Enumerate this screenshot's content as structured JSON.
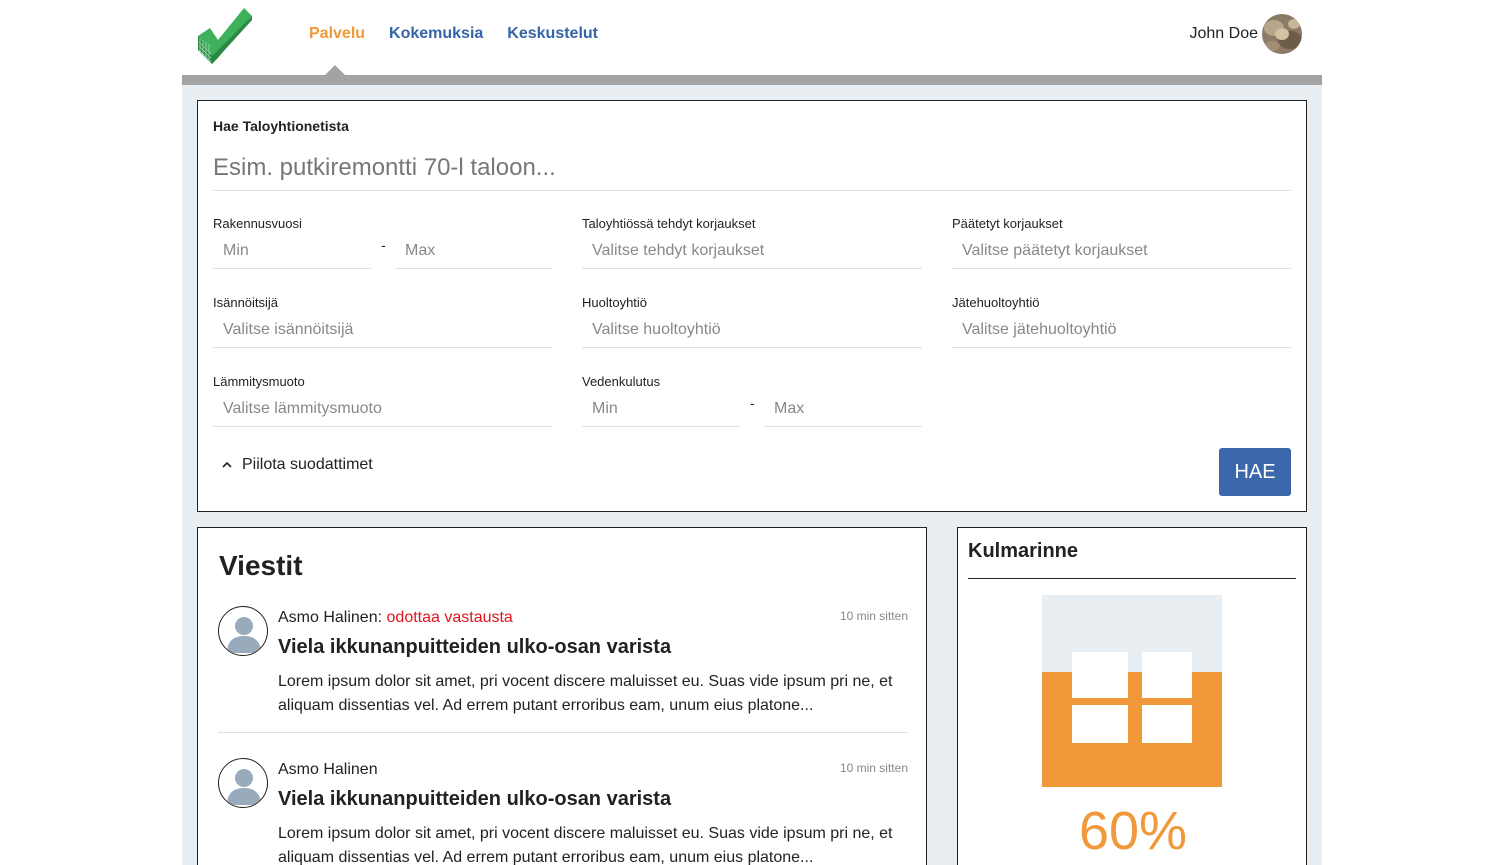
{
  "nav": {
    "items": [
      {
        "label": "Palvelu",
        "active": true
      },
      {
        "label": "Kokemuksia",
        "active": false
      },
      {
        "label": "Keskustelut",
        "active": false
      }
    ]
  },
  "user": {
    "name": "John Doe"
  },
  "search": {
    "title": "Hae Taloyhtionetista",
    "placeholder": "Esim. putkiremontti 70-l taloon...",
    "filters": {
      "rakennusvuosi": {
        "label": "Rakennusvuosi",
        "min_placeholder": "Min",
        "max_placeholder": "Max",
        "separator": "-"
      },
      "tehdyt": {
        "label": "Taloyhtiössä tehdyt korjaukset",
        "placeholder": "Valitse tehdyt korjaukset"
      },
      "paatetyt": {
        "label": "Päätetyt korjaukset",
        "placeholder": "Valitse päätetyt korjaukset"
      },
      "isannoitsija": {
        "label": "Isännöitsijä",
        "placeholder": "Valitse isännöitsijä"
      },
      "huoltoyhtio": {
        "label": "Huoltoyhtiö",
        "placeholder": "Valitse huoltoyhtiö"
      },
      "jatehuolto": {
        "label": "Jätehuoltoyhtiö",
        "placeholder": "Valitse jätehuoltoyhtiö"
      },
      "lammitys": {
        "label": "Lämmitysmuoto",
        "placeholder": "Valitse lämmitysmuoto"
      },
      "vedenkulutus": {
        "label": "Vedenkulutus",
        "min_placeholder": "Min",
        "max_placeholder": "Max",
        "separator": "-"
      }
    },
    "toggle_label": "Piilota suodattimet",
    "submit_label": "HAE"
  },
  "messages": {
    "title": "Viestit",
    "items": [
      {
        "author": "Asmo Halinen",
        "author_suffix": ":",
        "status": "odottaa vastausta",
        "time": "10 min sitten",
        "subject": "Viela ikkunanpuitteiden ulko-osan varista",
        "body": "Lorem ipsum dolor sit amet, pri vocent discere maluisset eu. Suas vide ipsum pri ne, et aliquam dissentias vel. Ad errem putant erroribus eam, unum eius platone..."
      },
      {
        "author": "Asmo Halinen",
        "author_suffix": "",
        "status": "",
        "time": "10 min sitten",
        "subject": "Viela ikkunanpuitteiden ulko-osan varista",
        "body": "Lorem ipsum dolor sit amet, pri vocent discere maluisset eu. Suas vide ipsum pri ne, et aliquam dissentias vel. Ad errem putant erroribus eam, unum eius platone..."
      }
    ]
  },
  "poll": {
    "title": "Kulmarinne",
    "percent_label": "60%",
    "fill_fraction": 0.6
  },
  "colors": {
    "accent_orange": "#f0983a",
    "link_blue": "#3465a8",
    "button_blue": "#3a68aa",
    "status_red": "#e0161b",
    "logo_green": "#3db25a"
  }
}
